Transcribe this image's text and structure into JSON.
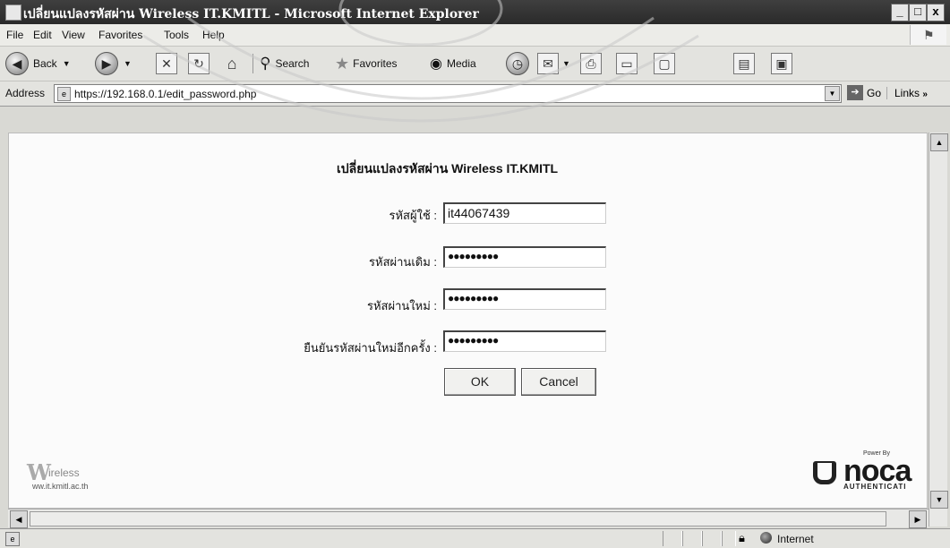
{
  "window": {
    "title": "เปลี่ยนแปลงรหัสผ่าน Wireless IT.KMITL - Microsoft Internet Explorer",
    "minimize": "_",
    "maximize": "□",
    "close": "x"
  },
  "menu": {
    "items": [
      "File",
      "Edit",
      "View",
      "Favorites",
      "Tools",
      "Help"
    ]
  },
  "toolbar": {
    "back_label": "Back",
    "search_label": "Search",
    "favorites_label": "Favorites",
    "media_label": "Media"
  },
  "address": {
    "label": "Address",
    "url": "https://192.168.0.1/edit_password.php",
    "go_label": "Go",
    "links_label": "Links"
  },
  "form": {
    "title": "เปลี่ยนแปลงรหัสผ่าน Wireless IT.KMITL",
    "username_label": "รหัสผู้ใช้ :",
    "username_value": "it44067439",
    "old_password_label": "รหัสผ่านเดิม :",
    "old_password_value": "●●●●●●●●●",
    "new_password_label": "รหัสผ่านใหม่ :",
    "new_password_value": "●●●●●●●●●",
    "confirm_password_label": "ยืนยันรหัสผ่านใหม่อีกครั้ง :",
    "confirm_password_value": "●●●●●●●●●",
    "ok_label": "OK",
    "cancel_label": "Cancel"
  },
  "footer": {
    "left_logo_big": "W",
    "left_logo_small": "ireless",
    "left_logo_url": "ww.it.kmitl.ac.th",
    "right_logo_powered": "Power By",
    "right_logo_word": "noca",
    "right_logo_sub": "AUTHENTICATI"
  },
  "status": {
    "zone": "Internet"
  },
  "colors": {
    "titlebar": "#2f2f2f",
    "chrome": "#e3e3df",
    "content_bg": "#fbfbfb"
  }
}
